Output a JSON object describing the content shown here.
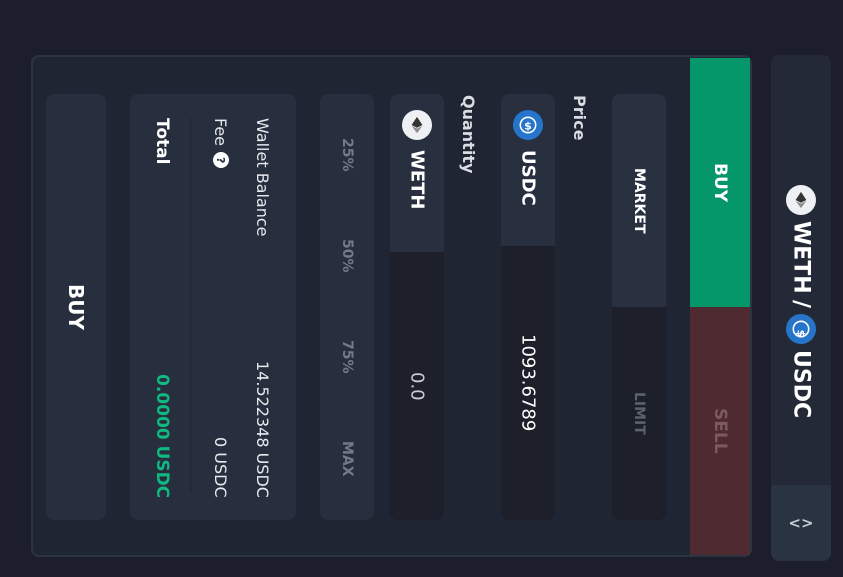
{
  "pair": {
    "base": "WETH",
    "separator": "/",
    "quote": "USDC",
    "base_icon": "eth-icon",
    "quote_icon": "usdc-icon"
  },
  "side_toggle": {
    "label": "<>",
    "icon": "code-brackets-icon"
  },
  "tabs": {
    "buy": "BUY",
    "sell": "SELL",
    "active": "buy"
  },
  "order_type": {
    "market": "MARKET",
    "limit": "LIMIT",
    "active": "market"
  },
  "price": {
    "label": "Price",
    "token": "USDC",
    "value": "1093.6789"
  },
  "quantity": {
    "label": "Quantity",
    "token": "WETH",
    "value": "0.0"
  },
  "percent_buttons": [
    "25%",
    "50%",
    "75%",
    "MAX"
  ],
  "summary": {
    "wallet_balance_label": "Wallet Balance",
    "wallet_balance_value": "14.522348 USDC",
    "fee_label": "Fee",
    "fee_help": "?",
    "fee_value": "0 USDC",
    "total_label": "Total",
    "total_value": "0.0000 USDC"
  },
  "submit_label": "BUY",
  "colors": {
    "buy": "#059669",
    "sell": "#4f2a31",
    "total": "#10b981",
    "usdc": "#2775ca"
  }
}
